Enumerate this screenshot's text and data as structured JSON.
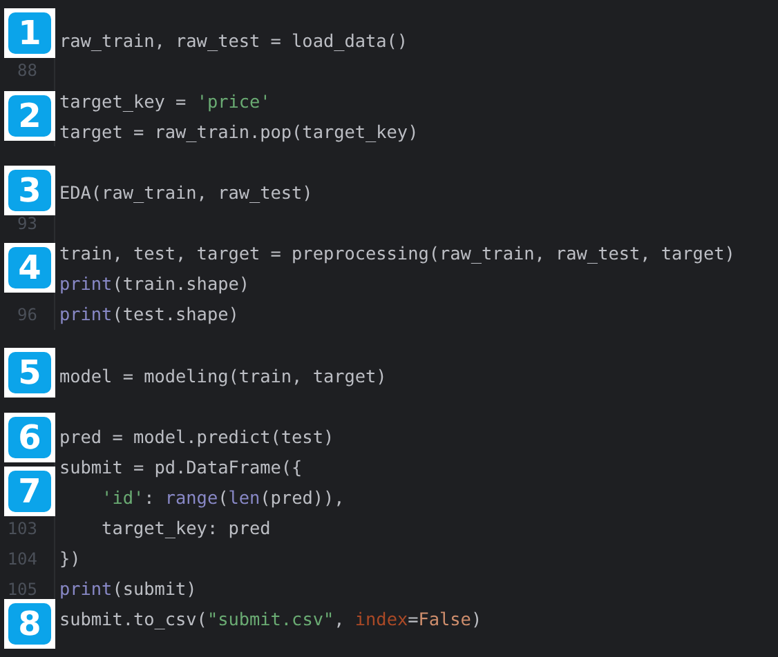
{
  "editor": {
    "lines": [
      {
        "kind": "blank"
      },
      {
        "tokens": [
          {
            "text": "raw_train, raw_test = load_data()",
            "kind": "plain"
          }
        ]
      },
      {
        "number": "88"
      },
      {
        "tokens": [
          {
            "text": "target_key = ",
            "kind": "plain"
          },
          {
            "text": "'price'",
            "kind": "string"
          }
        ]
      },
      {
        "tokens": [
          {
            "text": "target = raw_train.pop(target_key)",
            "kind": "plain"
          }
        ]
      },
      {
        "kind": "blank"
      },
      {
        "tokens": [
          {
            "text": "EDA(raw_train, raw_test)",
            "kind": "plain"
          }
        ]
      },
      {
        "number": "93"
      },
      {
        "tokens": [
          {
            "text": "train, test, target = preprocessing(raw_train, raw_test, target)",
            "kind": "plain"
          }
        ]
      },
      {
        "tokens": [
          {
            "text": "print",
            "kind": "builtin"
          },
          {
            "text": "(train.shape)",
            "kind": "plain"
          }
        ]
      },
      {
        "number": "96",
        "tokens": [
          {
            "text": "print",
            "kind": "builtin"
          },
          {
            "text": "(test.shape)",
            "kind": "plain"
          }
        ]
      },
      {
        "kind": "blank"
      },
      {
        "tokens": [
          {
            "text": "model = modeling(train, target)",
            "kind": "plain"
          }
        ]
      },
      {
        "kind": "blank"
      },
      {
        "tokens": [
          {
            "text": "pred = model.predict(test)",
            "kind": "plain"
          }
        ]
      },
      {
        "tokens": [
          {
            "text": "submit = pd.DataFrame({",
            "kind": "plain"
          }
        ]
      },
      {
        "tokens": [
          {
            "text": "    'id'",
            "kind": "string"
          },
          {
            "text": ": ",
            "kind": "plain"
          },
          {
            "text": "range",
            "kind": "builtin"
          },
          {
            "text": "(",
            "kind": "plain"
          },
          {
            "text": "len",
            "kind": "builtin"
          },
          {
            "text": "(pred)),",
            "kind": "plain"
          }
        ]
      },
      {
        "number": "103",
        "tokens": [
          {
            "text": "    target_key: pred",
            "kind": "plain"
          }
        ]
      },
      {
        "number": "104",
        "tokens": [
          {
            "text": "})",
            "kind": "plain"
          }
        ]
      },
      {
        "number": "105",
        "tokens": [
          {
            "text": "print",
            "kind": "builtin"
          },
          {
            "text": "(submit)",
            "kind": "plain"
          }
        ]
      },
      {
        "tokens": [
          {
            "text": "submit.to_csv(",
            "kind": "plain"
          },
          {
            "text": "\"submit.csv\"",
            "kind": "string"
          },
          {
            "text": ", ",
            "kind": "plain"
          },
          {
            "text": "index",
            "kind": "keyword_arg"
          },
          {
            "text": "=",
            "kind": "plain"
          },
          {
            "text": "False",
            "kind": "constant"
          },
          {
            "text": ")",
            "kind": "plain"
          }
        ]
      },
      {
        "kind": "blank"
      }
    ]
  },
  "badges": [
    {
      "label": "1"
    },
    {
      "label": "2"
    },
    {
      "label": "3"
    },
    {
      "label": "4"
    },
    {
      "label": "5"
    },
    {
      "label": "6"
    },
    {
      "label": "7"
    },
    {
      "label": "8"
    }
  ]
}
